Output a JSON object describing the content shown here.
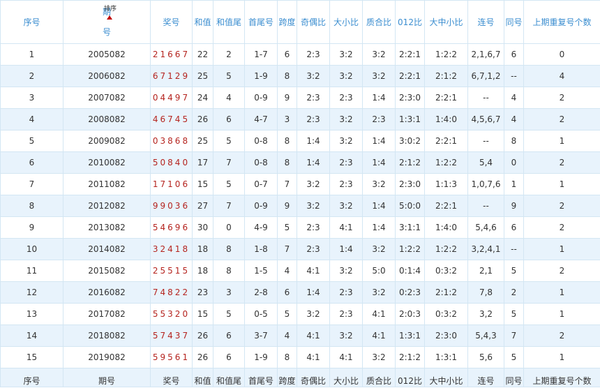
{
  "header": {
    "seq": "序号",
    "issue_top": "期",
    "issue_bottom": "号",
    "sort_label": "排序",
    "draw": "奖号",
    "sum": "和值",
    "sum_tail": "和值尾",
    "first_last": "首尾号",
    "span": "跨度",
    "odd_even": "奇偶比",
    "big_small": "大小比",
    "prime_comp": "质合比",
    "ratio012": "012比",
    "big_mid_small": "大中小比",
    "consecutive": "连号",
    "same": "同号",
    "repeat_prev": "上期重复号个数"
  },
  "footer": {
    "seq": "序号",
    "issue": "期号",
    "draw": "奖号",
    "sum": "和值",
    "sum_tail": "和值尾",
    "first_last": "首尾号",
    "span": "跨度",
    "odd_even": "奇偶比",
    "big_small": "大小比",
    "prime_comp": "质合比",
    "ratio012": "012比",
    "big_mid_small": "大中小比",
    "consecutive": "连号",
    "same": "同号",
    "repeat_prev": "上期重复号个数"
  },
  "rows": [
    {
      "seq": "1",
      "issue": "2005082",
      "draw": "21667",
      "sum": "22",
      "tail": "2",
      "fl": "1-7",
      "span": "6",
      "oe": "2:3",
      "bs": "3:2",
      "pc": "3:2",
      "r012": "2:2:1",
      "bms": "1:2:2",
      "cons": "2,1,6,7",
      "same": "6",
      "rep": "0"
    },
    {
      "seq": "2",
      "issue": "2006082",
      "draw": "67129",
      "sum": "25",
      "tail": "5",
      "fl": "1-9",
      "span": "8",
      "oe": "3:2",
      "bs": "3:2",
      "pc": "3:2",
      "r012": "2:2:1",
      "bms": "2:1:2",
      "cons": "6,7,1,2",
      "same": "--",
      "rep": "4"
    },
    {
      "seq": "3",
      "issue": "2007082",
      "draw": "04497",
      "sum": "24",
      "tail": "4",
      "fl": "0-9",
      "span": "9",
      "oe": "2:3",
      "bs": "2:3",
      "pc": "1:4",
      "r012": "2:3:0",
      "bms": "2:2:1",
      "cons": "--",
      "same": "4",
      "rep": "2"
    },
    {
      "seq": "4",
      "issue": "2008082",
      "draw": "46745",
      "sum": "26",
      "tail": "6",
      "fl": "4-7",
      "span": "3",
      "oe": "2:3",
      "bs": "3:2",
      "pc": "2:3",
      "r012": "1:3:1",
      "bms": "1:4:0",
      "cons": "4,5,6,7",
      "same": "4",
      "rep": "2"
    },
    {
      "seq": "5",
      "issue": "2009082",
      "draw": "03868",
      "sum": "25",
      "tail": "5",
      "fl": "0-8",
      "span": "8",
      "oe": "1:4",
      "bs": "3:2",
      "pc": "1:4",
      "r012": "3:0:2",
      "bms": "2:2:1",
      "cons": "--",
      "same": "8",
      "rep": "1"
    },
    {
      "seq": "6",
      "issue": "2010082",
      "draw": "50840",
      "sum": "17",
      "tail": "7",
      "fl": "0-8",
      "span": "8",
      "oe": "1:4",
      "bs": "2:3",
      "pc": "1:4",
      "r012": "2:1:2",
      "bms": "1:2:2",
      "cons": "5,4",
      "same": "0",
      "rep": "2"
    },
    {
      "seq": "7",
      "issue": "2011082",
      "draw": "17106",
      "sum": "15",
      "tail": "5",
      "fl": "0-7",
      "span": "7",
      "oe": "3:2",
      "bs": "2:3",
      "pc": "3:2",
      "r012": "2:3:0",
      "bms": "1:1:3",
      "cons": "1,0,7,6",
      "same": "1",
      "rep": "1"
    },
    {
      "seq": "8",
      "issue": "2012082",
      "draw": "99036",
      "sum": "27",
      "tail": "7",
      "fl": "0-9",
      "span": "9",
      "oe": "3:2",
      "bs": "3:2",
      "pc": "1:4",
      "r012": "5:0:0",
      "bms": "2:2:1",
      "cons": "--",
      "same": "9",
      "rep": "2"
    },
    {
      "seq": "9",
      "issue": "2013082",
      "draw": "54696",
      "sum": "30",
      "tail": "0",
      "fl": "4-9",
      "span": "5",
      "oe": "2:3",
      "bs": "4:1",
      "pc": "1:4",
      "r012": "3:1:1",
      "bms": "1:4:0",
      "cons": "5,4,6",
      "same": "6",
      "rep": "2"
    },
    {
      "seq": "10",
      "issue": "2014082",
      "draw": "32418",
      "sum": "18",
      "tail": "8",
      "fl": "1-8",
      "span": "7",
      "oe": "2:3",
      "bs": "1:4",
      "pc": "3:2",
      "r012": "1:2:2",
      "bms": "1:2:2",
      "cons": "3,2,4,1",
      "same": "--",
      "rep": "1"
    },
    {
      "seq": "11",
      "issue": "2015082",
      "draw": "25515",
      "sum": "18",
      "tail": "8",
      "fl": "1-5",
      "span": "4",
      "oe": "4:1",
      "bs": "3:2",
      "pc": "5:0",
      "r012": "0:1:4",
      "bms": "0:3:2",
      "cons": "2,1",
      "same": "5",
      "rep": "2"
    },
    {
      "seq": "12",
      "issue": "2016082",
      "draw": "74822",
      "sum": "23",
      "tail": "3",
      "fl": "2-8",
      "span": "6",
      "oe": "1:4",
      "bs": "2:3",
      "pc": "3:2",
      "r012": "0:2:3",
      "bms": "2:1:2",
      "cons": "7,8",
      "same": "2",
      "rep": "1"
    },
    {
      "seq": "13",
      "issue": "2017082",
      "draw": "55320",
      "sum": "15",
      "tail": "5",
      "fl": "0-5",
      "span": "5",
      "oe": "3:2",
      "bs": "2:3",
      "pc": "4:1",
      "r012": "2:0:3",
      "bms": "0:3:2",
      "cons": "3,2",
      "same": "5",
      "rep": "1"
    },
    {
      "seq": "14",
      "issue": "2018082",
      "draw": "57437",
      "sum": "26",
      "tail": "6",
      "fl": "3-7",
      "span": "4",
      "oe": "4:1",
      "bs": "3:2",
      "pc": "4:1",
      "r012": "1:3:1",
      "bms": "2:3:0",
      "cons": "5,4,3",
      "same": "7",
      "rep": "2"
    },
    {
      "seq": "15",
      "issue": "2019082",
      "draw": "59561",
      "sum": "26",
      "tail": "6",
      "fl": "1-9",
      "span": "8",
      "oe": "4:1",
      "bs": "4:1",
      "pc": "3:2",
      "r012": "2:1:2",
      "bms": "1:3:1",
      "cons": "5,6",
      "same": "5",
      "rep": "1"
    }
  ]
}
